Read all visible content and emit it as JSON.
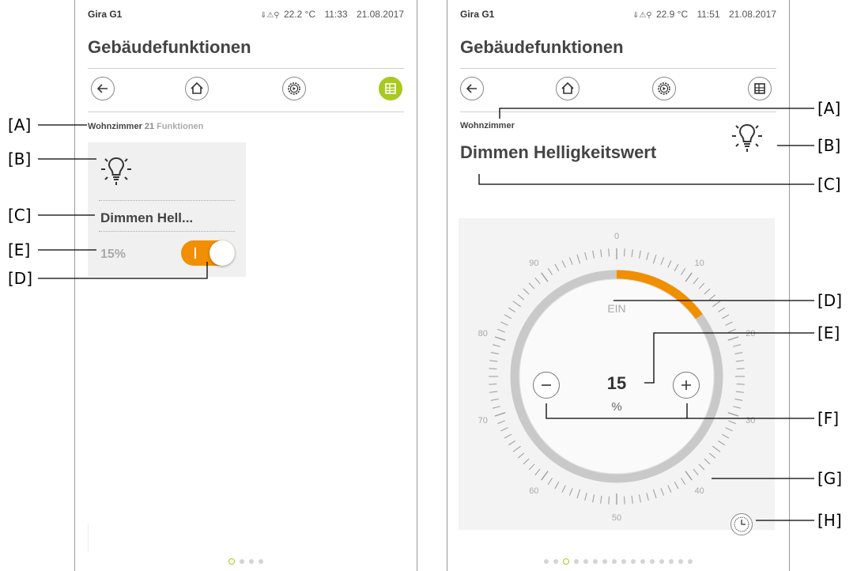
{
  "left": {
    "status": {
      "brand": "Gira G1",
      "icon": "⇓⚠⚲",
      "temp": "22.2 °C",
      "time": "11:33",
      "date": "21.08.2017"
    },
    "title": "Gebäudefunktionen",
    "breadcrumb": {
      "room": "Wohnzimmer",
      "count": "21",
      "label": "Funktionen"
    },
    "tile": {
      "label": "Dimmen Hell...",
      "value": "15%"
    },
    "toggle_on": true,
    "page_dots": 4,
    "active_dot": 0
  },
  "right": {
    "status": {
      "brand": "Gira G1",
      "icon": "⇓⚠⚲",
      "temp": "22.9 °C",
      "time": "11:51",
      "date": "21.08.2017"
    },
    "title": "Gebäudefunktionen",
    "room": "Wohnzimmer",
    "function_title": "Dimmen Helligkeitswert",
    "dial": {
      "status": "EIN",
      "value": "15",
      "unit": "%",
      "level_percent": 15,
      "scale_labels": [
        "0",
        "10",
        "20",
        "30",
        "40",
        "50",
        "60",
        "70",
        "80",
        "90"
      ],
      "accent": "#f18f00"
    },
    "page_dots": 16,
    "active_dot": 2
  },
  "callouts": {
    "left": [
      "[A]",
      "[B]",
      "[C]",
      "[E]",
      "[D]"
    ],
    "right": [
      "[A]",
      "[B]",
      "[C]",
      "[D]",
      "[E]",
      "[F]",
      "[G]",
      "[H]"
    ]
  },
  "colors": {
    "green_accent": "#a8c91e",
    "orange_accent": "#f18f00"
  }
}
